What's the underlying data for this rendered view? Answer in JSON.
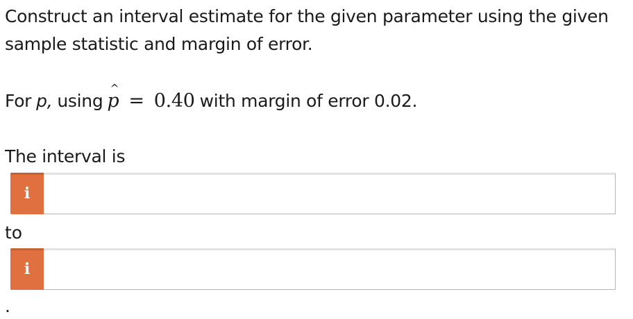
{
  "question": {
    "prompt": "Construct an interval estimate for the given parameter using the given sample statistic and margin of error.",
    "given_prefix": "For",
    "parameter": "p,",
    "given_using": "using",
    "statistic_symbol": "p",
    "statistic_hat": "^",
    "equals": "=",
    "statistic_value": "0.40",
    "margin_text": "with margin of error 0.02",
    "given_end": "."
  },
  "answer": {
    "interval_label": "The interval is",
    "to_label": "to",
    "info_icon_glyph": "i",
    "lower_value": "",
    "upper_value": "",
    "end_punctuation": ".",
    "info_color": "#e0703f"
  }
}
